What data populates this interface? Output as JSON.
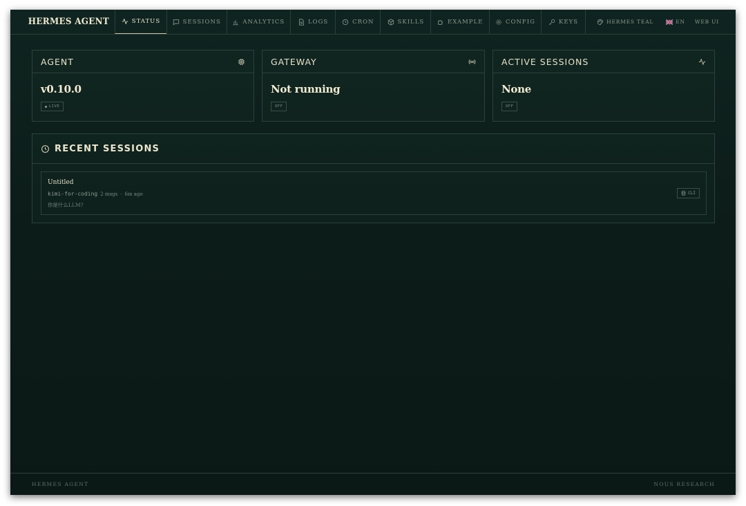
{
  "app": {
    "brand": "HERMES AGENT"
  },
  "nav": {
    "tabs": [
      {
        "id": "status",
        "label": "STATUS",
        "icon": "activity-icon",
        "active": true
      },
      {
        "id": "sessions",
        "label": "SESSIONS",
        "icon": "chat-icon",
        "active": false
      },
      {
        "id": "analytics",
        "label": "ANALYTICS",
        "icon": "bar-chart-icon",
        "active": false
      },
      {
        "id": "logs",
        "label": "LOGS",
        "icon": "file-text-icon",
        "active": false
      },
      {
        "id": "cron",
        "label": "CRON",
        "icon": "clock-icon",
        "active": false
      },
      {
        "id": "skills",
        "label": "SKILLS",
        "icon": "package-icon",
        "active": false
      },
      {
        "id": "example",
        "label": "EXAMPLE",
        "icon": "puzzle-icon",
        "active": false
      },
      {
        "id": "config",
        "label": "CONFIG",
        "icon": "gear-icon",
        "active": false
      },
      {
        "id": "keys",
        "label": "KEYS",
        "icon": "key-icon",
        "active": false
      }
    ],
    "theme_label": "HERMES TEAL",
    "language_label": "EN",
    "web_ui_label": "WEB UI"
  },
  "cards": {
    "agent": {
      "title": "AGENT",
      "value": "v0.10.0",
      "badge": "LIVE"
    },
    "gateway": {
      "title": "GATEWAY",
      "value": "Not running",
      "badge": "OFF"
    },
    "active_sessions": {
      "title": "ACTIVE SESSIONS",
      "value": "None",
      "badge": "OFF"
    }
  },
  "recent_sessions": {
    "title": "RECENT SESSIONS",
    "items": [
      {
        "title": "Untitled",
        "model": "kimi-for-coding",
        "msgs": "2 msgs",
        "sep": "·",
        "age": "6m ago",
        "preview": "你是什么LLM?",
        "action_label": "CLI"
      }
    ]
  },
  "footer": {
    "left": "HERMES AGENT",
    "right": "NOUS RESEARCH"
  },
  "colors": {
    "bg": "#0c1c19",
    "accent": "#efe9cf",
    "border": "#2d423c",
    "muted": "#8c9a8e"
  }
}
